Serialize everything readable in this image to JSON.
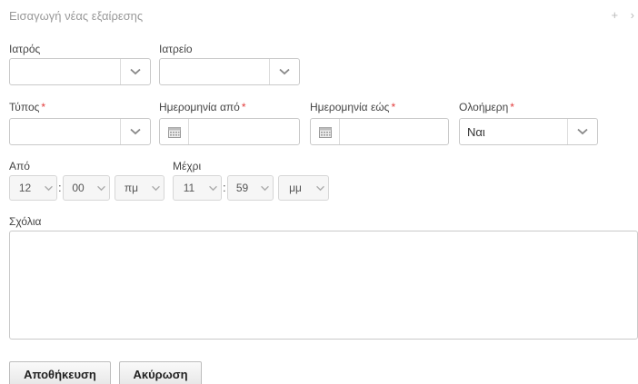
{
  "header": {
    "title": "Εισαγωγή νέας εξαίρεσης",
    "plus_icon": "+",
    "next_icon": "›"
  },
  "fields": {
    "doctor": {
      "label": "Ιατρός",
      "value": ""
    },
    "clinic": {
      "label": "Ιατρείο",
      "value": ""
    },
    "type": {
      "label": "Τύπος",
      "value": "",
      "required": "*"
    },
    "date_from": {
      "label": "Ημερομηνία από",
      "value": "",
      "required": "*"
    },
    "date_to": {
      "label": "Ημερομηνία εώς",
      "value": "",
      "required": "*"
    },
    "all_day": {
      "label": "Ολοήμερη",
      "value": "Ναι",
      "required": "*"
    },
    "from_time": {
      "label": "Από",
      "hour": "12",
      "minute": "00",
      "ampm": "πμ"
    },
    "to_time": {
      "label": "Μέχρι",
      "hour": "11",
      "minute": "59",
      "ampm": "μμ"
    },
    "comments": {
      "label": "Σχόλια",
      "value": ""
    }
  },
  "buttons": {
    "save": "Αποθήκευση",
    "cancel": "Ακύρωση"
  },
  "icons": {
    "caret": "chevron-down-icon",
    "calendar": "calendar-icon"
  },
  "colors": {
    "required": "#e23b3b",
    "border": "#c9c9c9"
  }
}
